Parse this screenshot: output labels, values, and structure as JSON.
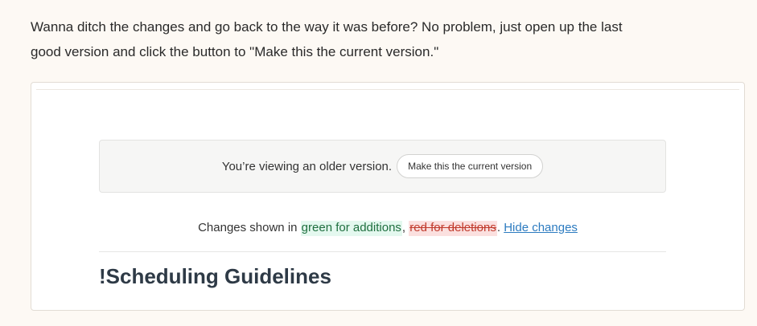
{
  "intro": {
    "line1": "Wanna ditch the changes and go back to the way it was before? No problem, just open up the last",
    "line2": "good version and click the button to \"Make this the current version.\""
  },
  "notice": {
    "text": "You’re viewing an older version.",
    "button_label": "Make this the current version"
  },
  "changes": {
    "prefix": "Changes shown in ",
    "additions": "green for additions",
    "separator": ", ",
    "deletions": "red for deletions",
    "period": ". ",
    "hide_link": "Hide changes"
  },
  "document": {
    "title": "!Scheduling Guidelines"
  },
  "colors": {
    "page_background": "#fdf9f4",
    "addition_highlight": "#e4f8ef",
    "deletion_highlight": "#fbe0df",
    "link": "#2c7bc0",
    "title": "#2e3a46"
  }
}
